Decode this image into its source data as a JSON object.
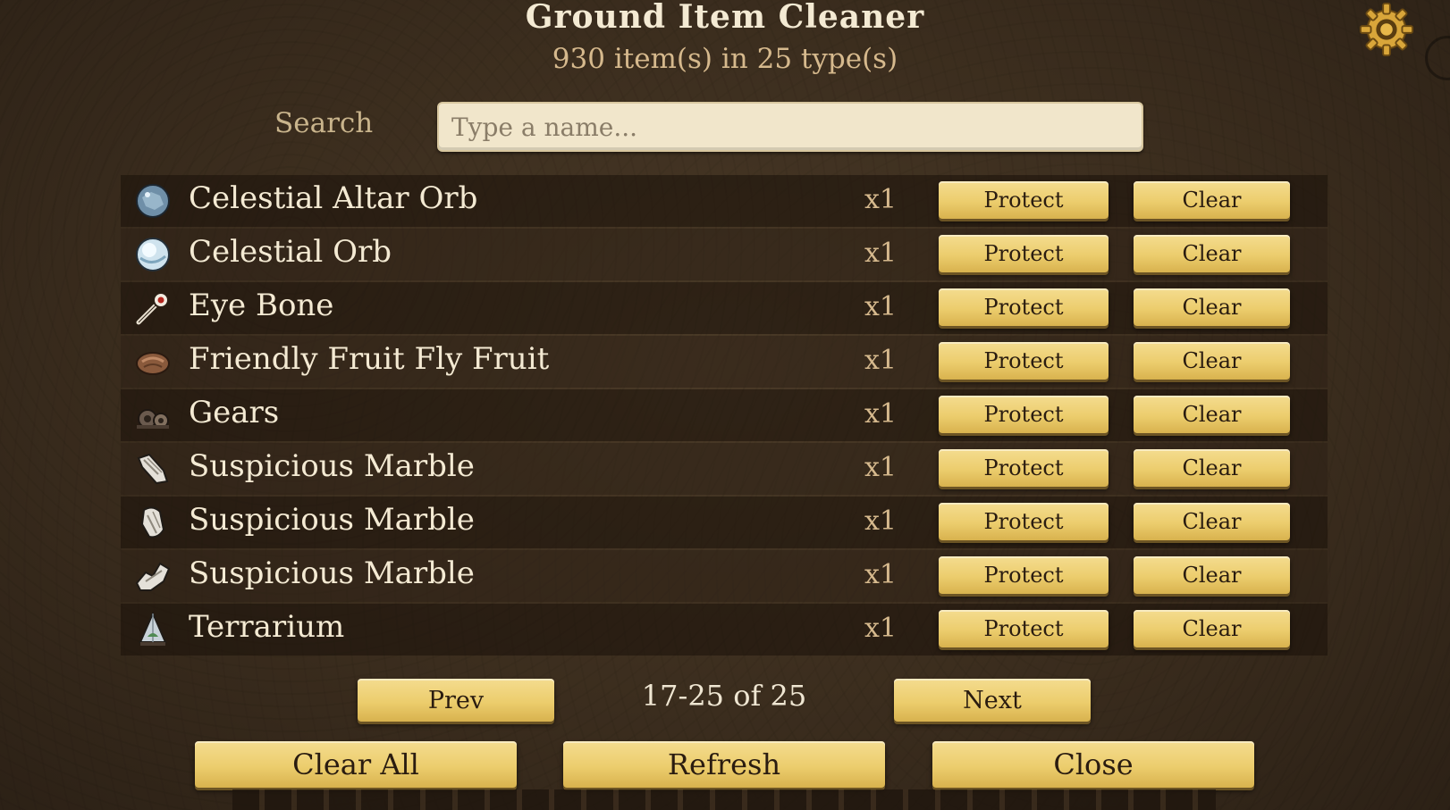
{
  "header": {
    "title": "Ground Item Cleaner",
    "subtitle": "930 item(s) in 25 type(s)"
  },
  "icons": {
    "settings": "gear-icon"
  },
  "search": {
    "label": "Search",
    "placeholder": "Type a name...",
    "value": ""
  },
  "items": [
    {
      "name": "Celestial Altar Orb",
      "qty": "x1",
      "icon": "celestial-altar-orb-icon"
    },
    {
      "name": "Celestial Orb",
      "qty": "x1",
      "icon": "celestial-orb-icon"
    },
    {
      "name": "Eye Bone",
      "qty": "x1",
      "icon": "eye-bone-icon"
    },
    {
      "name": "Friendly Fruit Fly Fruit",
      "qty": "x1",
      "icon": "fruit-fly-fruit-icon"
    },
    {
      "name": "Gears",
      "qty": "x1",
      "icon": "gears-icon"
    },
    {
      "name": "Suspicious Marble",
      "qty": "x1",
      "icon": "suspicious-marble-icon"
    },
    {
      "name": "Suspicious Marble",
      "qty": "x1",
      "icon": "suspicious-marble-icon"
    },
    {
      "name": "Suspicious Marble",
      "qty": "x1",
      "icon": "suspicious-marble-icon"
    },
    {
      "name": "Terrarium",
      "qty": "x1",
      "icon": "terrarium-icon"
    }
  ],
  "row_buttons": {
    "protect": "Protect",
    "clear": "Clear"
  },
  "pager": {
    "prev": "Prev",
    "next": "Next",
    "range": "17-25 of 25"
  },
  "footer": {
    "clear_all": "Clear All",
    "refresh": "Refresh",
    "close": "Close"
  },
  "colors": {
    "button_gold": "#eccd6d",
    "subtitle_tan": "#d6b98d",
    "background": "#3b2d1e"
  }
}
